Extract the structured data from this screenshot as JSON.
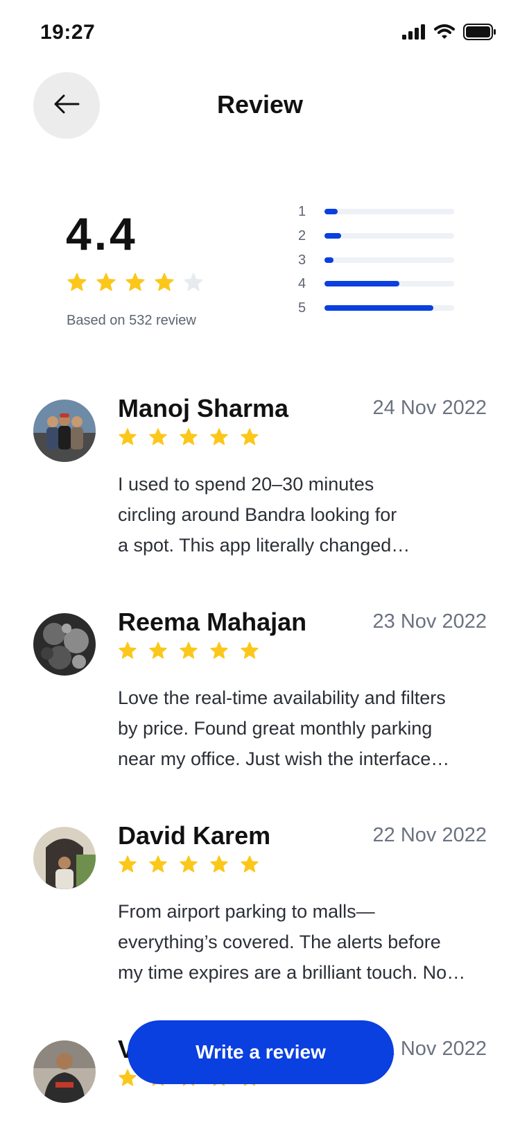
{
  "status_bar": {
    "time": "19:27"
  },
  "header": {
    "title": "Review"
  },
  "summary": {
    "rating": "4.4",
    "stars_filled": 4,
    "stars_total": 5,
    "caption": "Based on 532 review",
    "distribution": [
      {
        "label": "1",
        "fraction": 0.1
      },
      {
        "label": "2",
        "fraction": 0.13
      },
      {
        "label": "3",
        "fraction": 0.07
      },
      {
        "label": "4",
        "fraction": 0.58
      },
      {
        "label": "5",
        "fraction": 0.84
      }
    ]
  },
  "reviews": [
    {
      "name": "Manoj Sharma",
      "date": "24 Nov 2022",
      "rating": 5,
      "text": "I used to spend 20–30 minutes\ncircling around Bandra looking for\na spot. This app literally changed…"
    },
    {
      "name": "Reema Mahajan",
      "date": "23 Nov 2022",
      "rating": 5,
      "text": "Love the real-time availability and filters\nby price. Found great monthly parking\nnear my office. Just wish the interface…"
    },
    {
      "name": "David Karem",
      "date": "22 Nov 2022",
      "rating": 5,
      "text": "From airport parking to malls—\neverything’s covered. The alerts before\nmy time expires are a brilliant touch. No…"
    },
    {
      "name": "V",
      "date": "21 Nov 2022",
      "rating": 5,
      "text": ""
    }
  ],
  "cta": {
    "label": "Write a review"
  },
  "colors": {
    "accent": "#0a3fe0",
    "star": "#fbc71a",
    "star_empty": "#e7ebf0",
    "back_bg": "#ececec",
    "track": "#eef1f6"
  },
  "icons": {
    "back": "arrow-left-icon",
    "star": "star-icon",
    "signal": "signal-icon",
    "wifi": "wifi-icon",
    "battery": "battery-icon"
  }
}
